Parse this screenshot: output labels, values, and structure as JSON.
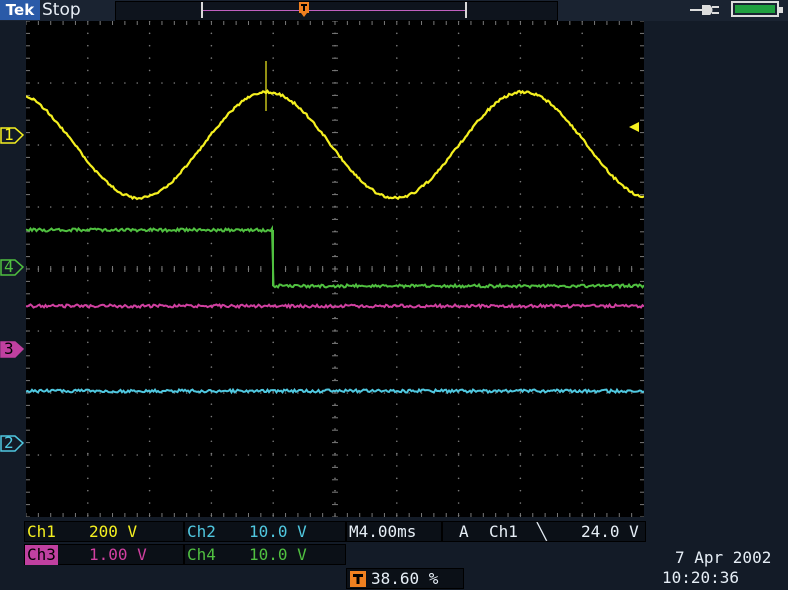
{
  "header": {
    "brand": "Tek",
    "acq_state": "Stop"
  },
  "trigger_marker": "T",
  "channel_markers": {
    "ch1": "1",
    "ch4": "4",
    "ch3": "3",
    "ch2": "2"
  },
  "readouts": {
    "ch1_label": "Ch1",
    "ch1_scale": "200 V",
    "ch2_label": "Ch2",
    "ch2_scale": "10.0 V",
    "ch3_label": "Ch3",
    "ch3_scale": "1.00 V",
    "ch4_label": "Ch4",
    "ch4_scale": "10.0 V",
    "timebase": "M4.00ms",
    "trigger_mode": "A",
    "trigger_source": "Ch1",
    "trigger_slope": "falling-edge",
    "trigger_slope_glyph": "╲",
    "trigger_level": "24.0 V",
    "trigger_position": "38.60 %",
    "date": "7 Apr  2002",
    "time": "10:20:36"
  },
  "colors": {
    "ch1": "#f5f020",
    "ch2": "#50c8e0",
    "ch3": "#d040a0",
    "ch4": "#50c040",
    "trigger": "#f08020",
    "background": "#000000"
  }
}
